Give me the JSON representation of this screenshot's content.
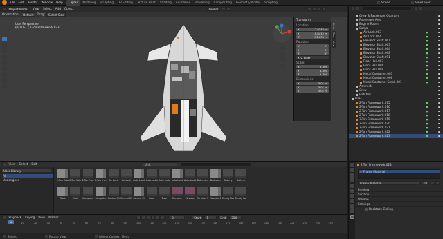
{
  "menus": [
    "File",
    "Edit",
    "Render",
    "Window",
    "Help"
  ],
  "workspace_tabs": [
    "Layout",
    "Modeling",
    "Sculpting",
    "UV Editing",
    "Texture Paint",
    "Shading",
    "Animation",
    "Rendering",
    "Compositing",
    "Geometry Nodes",
    "Scripting"
  ],
  "active_workspace": "Layout",
  "scene_name": "Scene",
  "view_layer": "ViewLayer",
  "viewport": {
    "mode": "Object Mode",
    "menus": [
      "View",
      "Select",
      "Add",
      "Object"
    ],
    "orientation_label": "Orientation:",
    "orientation": "Default",
    "drag_label": "Drag:",
    "drag": "Select Box",
    "transform_global": "Global",
    "info_line1": "User Perspective",
    "info_line2": "(0) FUEL | 2-Ton Framework.023"
  },
  "npanel": {
    "title": "Transform",
    "location_label": "Location:",
    "location": [
      [
        "X",
        "7.9342 m"
      ],
      [
        "Y",
        "-9.8412 m"
      ],
      [
        "Z",
        "-11.059 m"
      ]
    ],
    "rotation_label": "Rotation:",
    "rotation": [
      [
        "X",
        "0°"
      ],
      [
        "Y",
        "0°"
      ],
      [
        "Z",
        "0°"
      ]
    ],
    "rotation_mode": "XYZ Euler",
    "scale_label": "Scale:",
    "scale": [
      [
        "X",
        "1.000"
      ],
      [
        "Y",
        "1.000"
      ],
      [
        "Z",
        "1.000"
      ]
    ],
    "dimensions_label": "Dimensions:",
    "dimensions": [
      [
        "X",
        "3.01 m"
      ],
      [
        "Y",
        "3.01 m"
      ],
      [
        "Z",
        "3.01 m"
      ]
    ],
    "tabs": [
      "Item",
      "Tool",
      "View"
    ]
  },
  "outliner": {
    "search_placeholder": "",
    "rows": [
      {
        "label": "Crew & Passenger Quarters",
        "indent": 1,
        "kind": "coll"
      },
      {
        "label": "Passenger Area",
        "indent": 1,
        "kind": "coll"
      },
      {
        "label": "Engine Room",
        "indent": 1,
        "kind": "coll"
      },
      {
        "label": "Cargo",
        "indent": 1,
        "kind": "coll"
      },
      {
        "label": "Air Lock.003",
        "indent": 2,
        "kind": "mesh"
      },
      {
        "label": "Air Lock.004",
        "indent": 2,
        "kind": "mesh"
      },
      {
        "label": "Elevator Shaft.001",
        "indent": 2,
        "kind": "mesh"
      },
      {
        "label": "Elevator Shaft.003",
        "indent": 2,
        "kind": "mesh"
      },
      {
        "label": "Elevator Shaft.004",
        "indent": 2,
        "kind": "mesh"
      },
      {
        "label": "Elevator Shaft.008",
        "indent": 2,
        "kind": "mesh"
      },
      {
        "label": "Elevator Shaft.011",
        "indent": 2,
        "kind": "mesh"
      },
      {
        "label": "Floor Hall.003",
        "indent": 2,
        "kind": "mesh"
      },
      {
        "label": "Floor Hall.006",
        "indent": 2,
        "kind": "mesh"
      },
      {
        "label": "Floor Hall.009",
        "indent": 2,
        "kind": "mesh"
      },
      {
        "label": "Metal Container.003",
        "indent": 2,
        "kind": "mesh"
      },
      {
        "label": "Metal Container.006",
        "indent": 2,
        "kind": "mesh"
      },
      {
        "label": "Metal Container Small.001",
        "indent": 2,
        "kind": "mesh"
      },
      {
        "label": "Asteroids",
        "indent": 1,
        "kind": "coll"
      },
      {
        "label": "Crew",
        "indent": 1,
        "kind": "coll"
      },
      {
        "label": "Hatches",
        "indent": 1,
        "kind": "coll"
      },
      {
        "label": "FUEL",
        "indent": 0,
        "kind": "coll"
      },
      {
        "label": "2-Ton Framework.015",
        "indent": 1,
        "kind": "mesh"
      },
      {
        "label": "2-Ton Framework.016",
        "indent": 1,
        "kind": "mesh"
      },
      {
        "label": "2-Ton Framework.017",
        "indent": 1,
        "kind": "mesh"
      },
      {
        "label": "2-Ton Framework.018",
        "indent": 1,
        "kind": "mesh"
      },
      {
        "label": "2-Ton Framework.019",
        "indent": 1,
        "kind": "mesh"
      },
      {
        "label": "2-Ton Framework.020",
        "indent": 1,
        "kind": "mesh"
      },
      {
        "label": "2-Ton Framework.021",
        "indent": 1,
        "kind": "mesh"
      },
      {
        "label": "2-Ton Framework.022",
        "indent": 1,
        "kind": "mesh"
      },
      {
        "label": "2-Ton Framework.023",
        "indent": 1,
        "kind": "mesh"
      }
    ]
  },
  "properties": {
    "object_breadcrumb": "2-Ton Framework.023",
    "material_slot": "Frame Material",
    "material_name": "Frame Material",
    "material_users": "18",
    "sections": [
      "Preview",
      "Surface",
      "Volume",
      "Settings"
    ],
    "backface_culling": "Backface Culling"
  },
  "asset_browser": {
    "menus": [
      "View",
      "Select",
      "Edit"
    ],
    "library": "User Library",
    "catalogs": [
      "All",
      "Unassigned"
    ],
    "search_placeholder": "",
    "filter": "Unit",
    "row1": [
      "2-Ton Cabe",
      "2-Ton Cabe",
      "2-Ton Fra...",
      "2-Ton Fra...",
      "Air Lock",
      "Air Lock",
      "Auto Ladder",
      "Auto Ladde...",
      "Auto Ladde...",
      "Auto Ladde...",
      "Auto Ladde...",
      "Bathroom",
      "Bedroom",
      "Battery",
      "Battery"
    ],
    "row2": [
      "Chair",
      "Chair",
      "Computer",
      "Computer",
      "Control Chair",
      "Control Chair",
      "Control Cha...",
      "Door",
      "Door",
      "Elevator",
      "Elevator",
      "Elevator Shaft",
      "Elevator Shaft",
      "Empty Room",
      "Empty Room"
    ]
  },
  "timeline": {
    "menus": [
      "Playback",
      "Keying",
      "View",
      "Marker"
    ],
    "current_frame": "0",
    "start_label": "Start",
    "start": "1",
    "end_label": "End",
    "end": "250",
    "ruler": [
      "0",
      "10",
      "20",
      "30",
      "40",
      "50",
      "60",
      "70",
      "80",
      "90",
      "100",
      "110",
      "120",
      "130",
      "140",
      "150",
      "160",
      "170",
      "180",
      "190",
      "200",
      "210",
      "220",
      "230",
      "240",
      "250"
    ]
  },
  "statusbar": {
    "select": "Select",
    "rotate": "Rotate View",
    "context": "Object Context Menu"
  },
  "colors": {
    "accent": "#4772b3",
    "selected_orange": "#e87d0d",
    "visibility_green": "#6ecf6e",
    "background": "#1d1d1d"
  }
}
